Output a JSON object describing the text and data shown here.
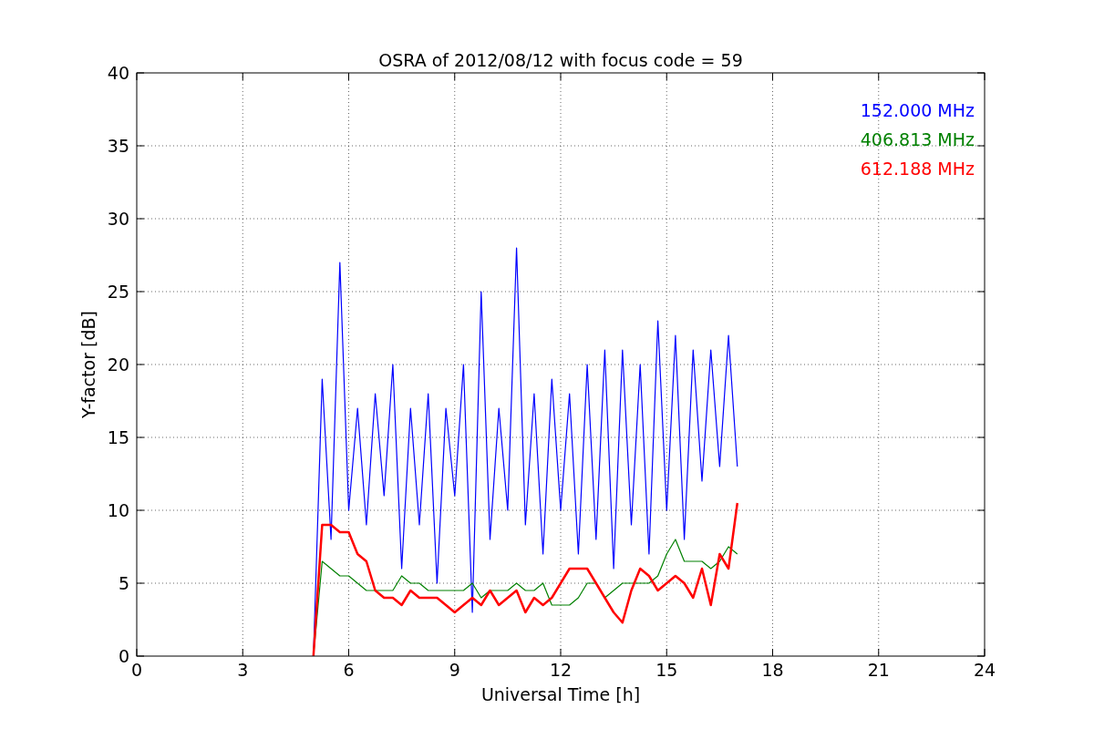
{
  "chart_data": {
    "type": "line",
    "title": "OSRA of 2012/08/12 with focus code = 59",
    "xlabel": "Universal Time [h]",
    "ylabel": "Y-factor [dB]",
    "x": [
      5.0,
      5.25,
      5.5,
      5.75,
      6.0,
      6.25,
      6.5,
      6.75,
      7.0,
      7.25,
      7.5,
      7.75,
      8.0,
      8.25,
      8.5,
      8.75,
      9.0,
      9.25,
      9.5,
      9.75,
      10.0,
      10.25,
      10.5,
      10.75,
      11.0,
      11.25,
      11.5,
      11.75,
      12.0,
      12.25,
      12.5,
      12.75,
      13.0,
      13.25,
      13.5,
      13.75,
      14.0,
      14.25,
      14.5,
      14.75,
      15.0,
      15.25,
      15.5,
      15.75,
      16.0,
      16.25,
      16.5,
      16.75,
      17.0
    ],
    "series": [
      {
        "name": "152.000 MHz",
        "color": "#0000ff",
        "values": [
          0,
          19,
          8,
          27,
          10,
          17,
          9,
          18,
          11,
          20,
          6,
          17,
          9,
          18,
          5,
          17,
          11,
          20,
          3,
          25,
          8,
          17,
          10,
          28,
          9,
          18,
          7,
          19,
          10,
          18,
          7,
          20,
          8,
          21,
          6,
          21,
          9,
          20,
          7,
          23,
          10,
          22,
          8,
          21,
          12,
          21,
          13,
          22,
          13
        ]
      },
      {
        "name": "406.813 MHz",
        "color": "#008000",
        "values": [
          0,
          6.5,
          6,
          5.5,
          5.5,
          5,
          4.5,
          4.5,
          4.5,
          4.5,
          5.5,
          5,
          5,
          4.5,
          4.5,
          4.5,
          4.5,
          4.5,
          5,
          4,
          4.5,
          4.5,
          4.5,
          5,
          4.5,
          4.5,
          5,
          3.5,
          3.5,
          3.5,
          4,
          5,
          5,
          4,
          4.5,
          5,
          5,
          5,
          5,
          5.5,
          7,
          8,
          6.5,
          6.5,
          6.5,
          6,
          6.5,
          7.5,
          7
        ]
      },
      {
        "name": "612.188 MHz",
        "color": "#ff0000",
        "values": [
          0,
          9,
          9,
          8.5,
          8.5,
          7,
          6.5,
          4.5,
          4,
          4,
          3.5,
          4.5,
          4,
          4,
          4,
          3.5,
          3,
          3.5,
          4,
          3.5,
          4.5,
          3.5,
          4,
          4.5,
          3,
          4,
          3.5,
          4,
          5,
          6,
          6,
          6,
          5,
          4,
          3,
          2.3,
          4.5,
          6,
          5.5,
          4.5,
          5,
          5.5,
          5,
          4,
          6,
          3.5,
          7,
          6,
          10.5
        ]
      }
    ],
    "grid": true,
    "xlim": [
      0,
      24
    ],
    "ylim": [
      0,
      40
    ],
    "xticks": [
      0,
      3,
      6,
      9,
      12,
      15,
      18,
      21,
      24
    ],
    "yticks": [
      0,
      5,
      10,
      15,
      20,
      25,
      30,
      35,
      40
    ]
  }
}
